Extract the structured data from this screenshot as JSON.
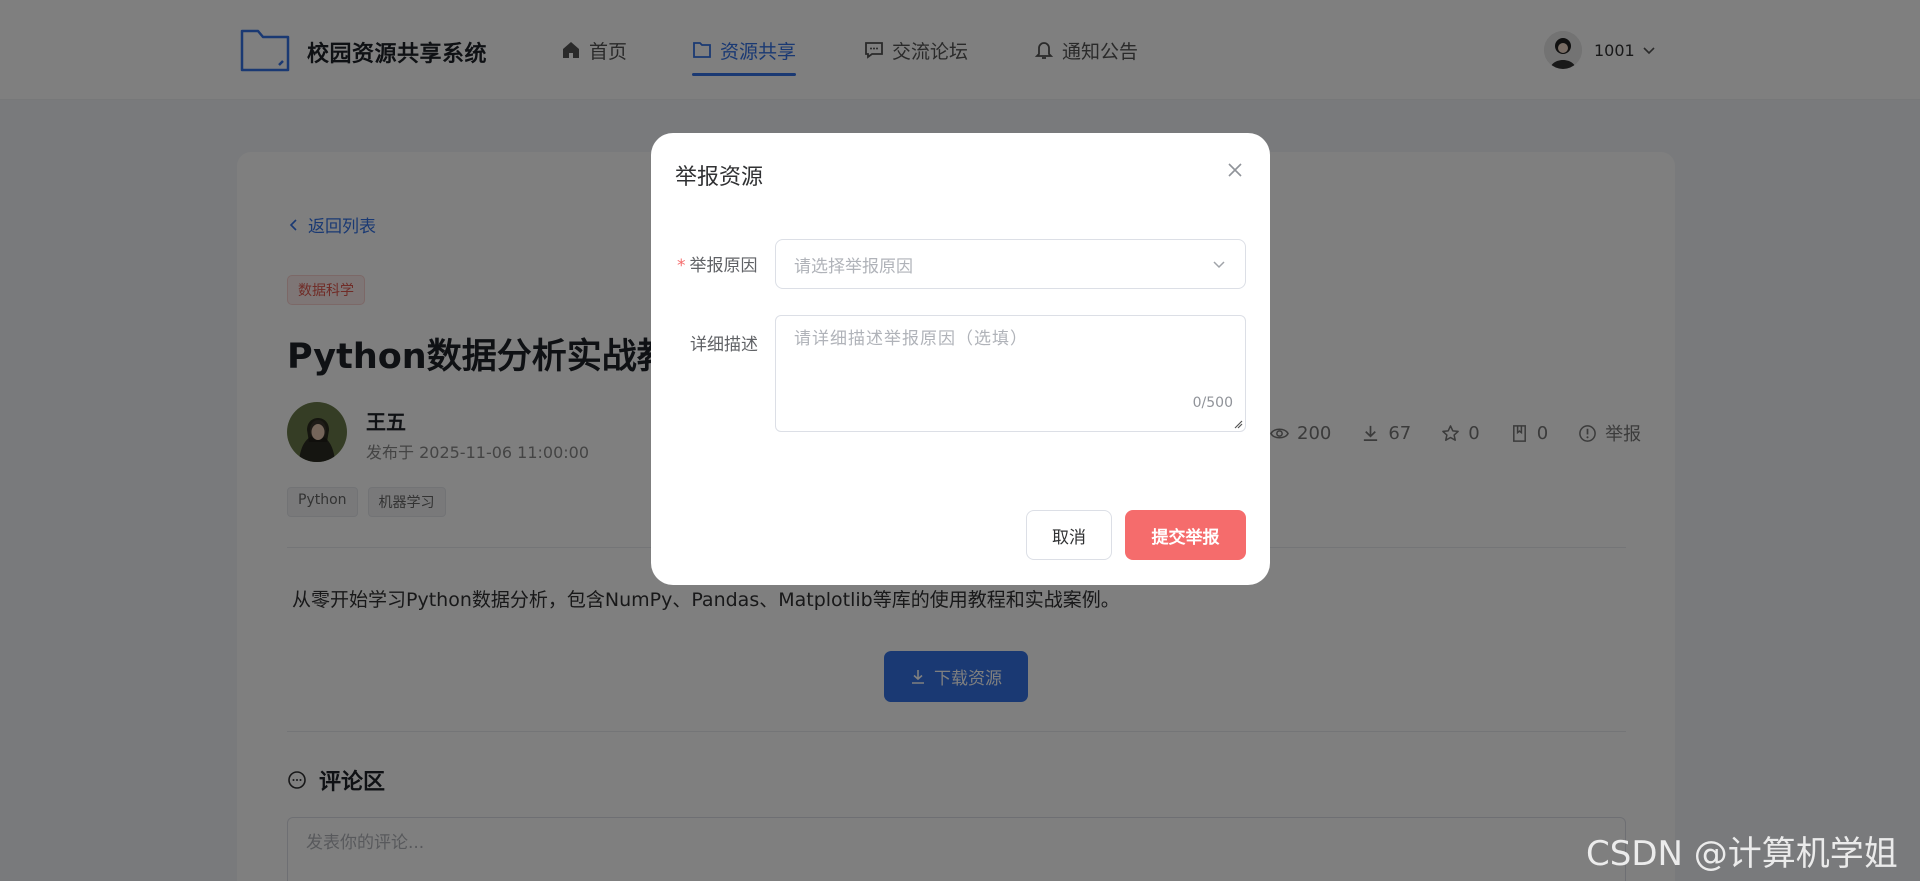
{
  "header": {
    "logo_text": "校园资源共享系统",
    "nav": [
      {
        "label": "首页",
        "icon": "home-icon"
      },
      {
        "label": "资源共享",
        "icon": "folder-icon",
        "active": true
      },
      {
        "label": "交流论坛",
        "icon": "chat-icon"
      },
      {
        "label": "通知公告",
        "icon": "bell-icon"
      }
    ],
    "user_id": "1001"
  },
  "detail": {
    "back_label": "返回列表",
    "category": "数据科学",
    "title": "Python数据分析实战教程",
    "author": "王五",
    "publish_time": "发布于 2025-11-06 11:00:00",
    "tags": [
      "Python",
      "机器学习"
    ],
    "stats": {
      "views": "200",
      "downloads": "67",
      "likes": "0",
      "favorites": "0",
      "report_label": "举报"
    },
    "description": "从零开始学习Python数据分析，包含NumPy、Pandas、Matplotlib等库的使用教程和实战案例。",
    "download_label": "下载资源",
    "comment_title": "评论区",
    "comment_placeholder": "发表你的评论..."
  },
  "dialog": {
    "title": "举报资源",
    "reason_label": "举报原因",
    "reason_placeholder": "请选择举报原因",
    "detail_label": "详细描述",
    "detail_placeholder": "请详细描述举报原因（选填）",
    "counter": "0/500",
    "cancel_label": "取消",
    "submit_label": "提交举报"
  },
  "watermark": "CSDN @计算机学姐",
  "colors": {
    "primary": "#3473e6",
    "danger": "#f56c6c",
    "overlay": "rgba(0,0,0,0.5)"
  }
}
